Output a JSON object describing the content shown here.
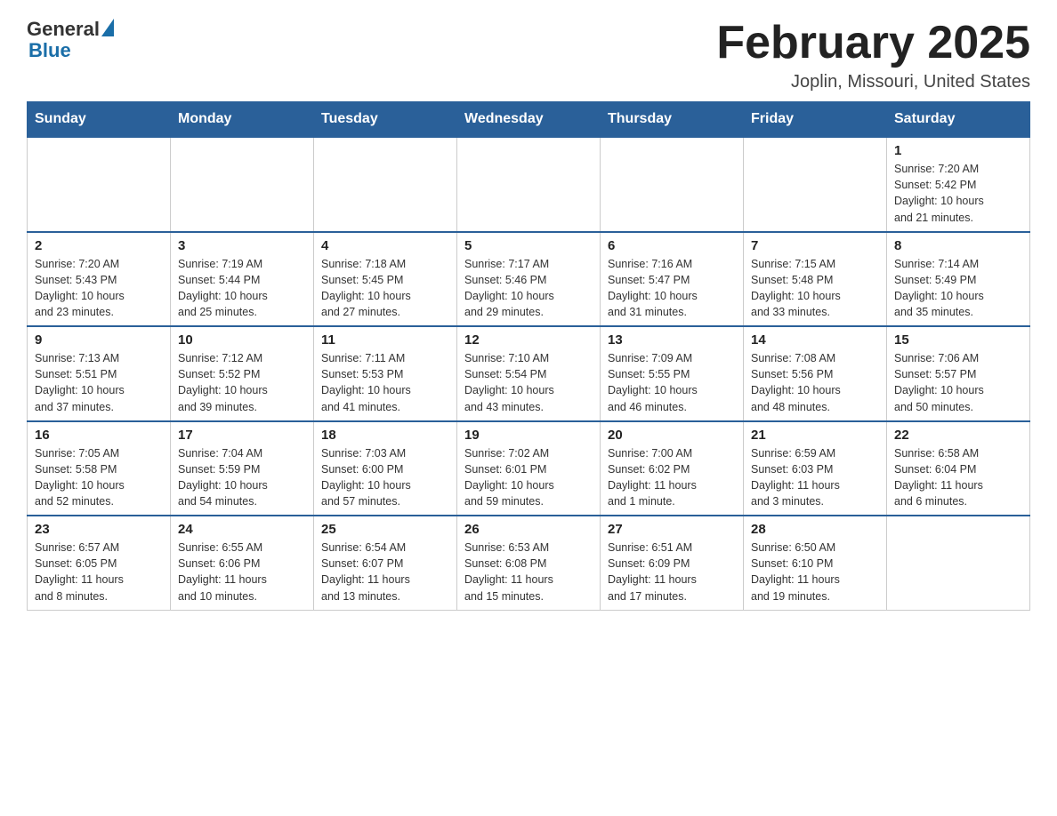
{
  "header": {
    "logo": {
      "general": "General",
      "blue": "Blue"
    },
    "month_year": "February 2025",
    "location": "Joplin, Missouri, United States"
  },
  "days_of_week": [
    "Sunday",
    "Monday",
    "Tuesday",
    "Wednesday",
    "Thursday",
    "Friday",
    "Saturday"
  ],
  "weeks": [
    [
      {
        "day": "",
        "info": ""
      },
      {
        "day": "",
        "info": ""
      },
      {
        "day": "",
        "info": ""
      },
      {
        "day": "",
        "info": ""
      },
      {
        "day": "",
        "info": ""
      },
      {
        "day": "",
        "info": ""
      },
      {
        "day": "1",
        "info": "Sunrise: 7:20 AM\nSunset: 5:42 PM\nDaylight: 10 hours\nand 21 minutes."
      }
    ],
    [
      {
        "day": "2",
        "info": "Sunrise: 7:20 AM\nSunset: 5:43 PM\nDaylight: 10 hours\nand 23 minutes."
      },
      {
        "day": "3",
        "info": "Sunrise: 7:19 AM\nSunset: 5:44 PM\nDaylight: 10 hours\nand 25 minutes."
      },
      {
        "day": "4",
        "info": "Sunrise: 7:18 AM\nSunset: 5:45 PM\nDaylight: 10 hours\nand 27 minutes."
      },
      {
        "day": "5",
        "info": "Sunrise: 7:17 AM\nSunset: 5:46 PM\nDaylight: 10 hours\nand 29 minutes."
      },
      {
        "day": "6",
        "info": "Sunrise: 7:16 AM\nSunset: 5:47 PM\nDaylight: 10 hours\nand 31 minutes."
      },
      {
        "day": "7",
        "info": "Sunrise: 7:15 AM\nSunset: 5:48 PM\nDaylight: 10 hours\nand 33 minutes."
      },
      {
        "day": "8",
        "info": "Sunrise: 7:14 AM\nSunset: 5:49 PM\nDaylight: 10 hours\nand 35 minutes."
      }
    ],
    [
      {
        "day": "9",
        "info": "Sunrise: 7:13 AM\nSunset: 5:51 PM\nDaylight: 10 hours\nand 37 minutes."
      },
      {
        "day": "10",
        "info": "Sunrise: 7:12 AM\nSunset: 5:52 PM\nDaylight: 10 hours\nand 39 minutes."
      },
      {
        "day": "11",
        "info": "Sunrise: 7:11 AM\nSunset: 5:53 PM\nDaylight: 10 hours\nand 41 minutes."
      },
      {
        "day": "12",
        "info": "Sunrise: 7:10 AM\nSunset: 5:54 PM\nDaylight: 10 hours\nand 43 minutes."
      },
      {
        "day": "13",
        "info": "Sunrise: 7:09 AM\nSunset: 5:55 PM\nDaylight: 10 hours\nand 46 minutes."
      },
      {
        "day": "14",
        "info": "Sunrise: 7:08 AM\nSunset: 5:56 PM\nDaylight: 10 hours\nand 48 minutes."
      },
      {
        "day": "15",
        "info": "Sunrise: 7:06 AM\nSunset: 5:57 PM\nDaylight: 10 hours\nand 50 minutes."
      }
    ],
    [
      {
        "day": "16",
        "info": "Sunrise: 7:05 AM\nSunset: 5:58 PM\nDaylight: 10 hours\nand 52 minutes."
      },
      {
        "day": "17",
        "info": "Sunrise: 7:04 AM\nSunset: 5:59 PM\nDaylight: 10 hours\nand 54 minutes."
      },
      {
        "day": "18",
        "info": "Sunrise: 7:03 AM\nSunset: 6:00 PM\nDaylight: 10 hours\nand 57 minutes."
      },
      {
        "day": "19",
        "info": "Sunrise: 7:02 AM\nSunset: 6:01 PM\nDaylight: 10 hours\nand 59 minutes."
      },
      {
        "day": "20",
        "info": "Sunrise: 7:00 AM\nSunset: 6:02 PM\nDaylight: 11 hours\nand 1 minute."
      },
      {
        "day": "21",
        "info": "Sunrise: 6:59 AM\nSunset: 6:03 PM\nDaylight: 11 hours\nand 3 minutes."
      },
      {
        "day": "22",
        "info": "Sunrise: 6:58 AM\nSunset: 6:04 PM\nDaylight: 11 hours\nand 6 minutes."
      }
    ],
    [
      {
        "day": "23",
        "info": "Sunrise: 6:57 AM\nSunset: 6:05 PM\nDaylight: 11 hours\nand 8 minutes."
      },
      {
        "day": "24",
        "info": "Sunrise: 6:55 AM\nSunset: 6:06 PM\nDaylight: 11 hours\nand 10 minutes."
      },
      {
        "day": "25",
        "info": "Sunrise: 6:54 AM\nSunset: 6:07 PM\nDaylight: 11 hours\nand 13 minutes."
      },
      {
        "day": "26",
        "info": "Sunrise: 6:53 AM\nSunset: 6:08 PM\nDaylight: 11 hours\nand 15 minutes."
      },
      {
        "day": "27",
        "info": "Sunrise: 6:51 AM\nSunset: 6:09 PM\nDaylight: 11 hours\nand 17 minutes."
      },
      {
        "day": "28",
        "info": "Sunrise: 6:50 AM\nSunset: 6:10 PM\nDaylight: 11 hours\nand 19 minutes."
      },
      {
        "day": "",
        "info": ""
      }
    ]
  ]
}
